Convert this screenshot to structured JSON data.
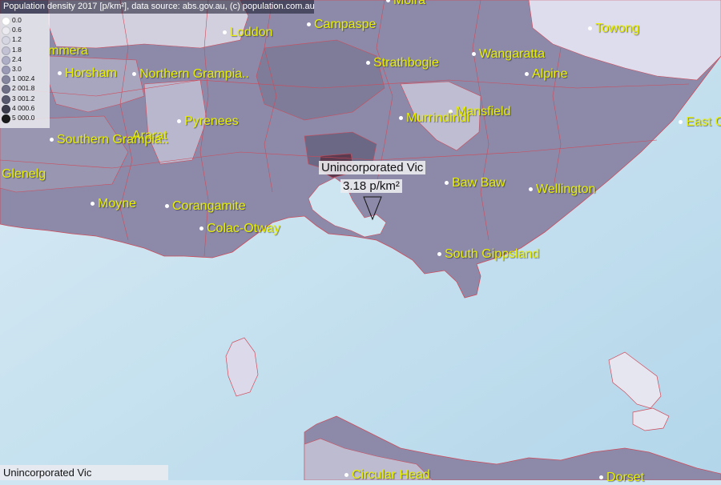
{
  "header": {
    "title": "Population density 2017 [p/km²], data source: abs.gov.au, (c) population.com.au"
  },
  "legend": {
    "items": [
      {
        "label": "0.0",
        "color": "#ffffff"
      },
      {
        "label": "0.6",
        "color": "#eaeaf0"
      },
      {
        "label": "1.2",
        "color": "#d6d6e2"
      },
      {
        "label": "1.8",
        "color": "#c2c2d4"
      },
      {
        "label": "2.4",
        "color": "#aeaec6"
      },
      {
        "label": "3.0",
        "color": "#9a9ab6"
      },
      {
        "label": "1 002.4",
        "color": "#85859f"
      },
      {
        "label": "2 001.8",
        "color": "#6f6f88"
      },
      {
        "label": "3 001.2",
        "color": "#58586e"
      },
      {
        "label": "4 000.6",
        "color": "#3c3c4c"
      },
      {
        "label": "5 000.0",
        "color": "#1a1a1a"
      }
    ]
  },
  "places": [
    {
      "name": "Moira"
    },
    {
      "name": "Campaspe"
    },
    {
      "name": "Loddon"
    },
    {
      "name": "Towong"
    },
    {
      "name": "Wangaratta"
    },
    {
      "name": "Strathbogie"
    },
    {
      "name": "Alpine"
    },
    {
      "name": "mmera"
    },
    {
      "name": "Horsham"
    },
    {
      "name": "Northern Grampia.."
    },
    {
      "name": "Mansfield"
    },
    {
      "name": "Murrindindi"
    },
    {
      "name": "Pyrenees"
    },
    {
      "name": "East G"
    },
    {
      "name": "Ararat"
    },
    {
      "name": "Southern Grampia.."
    },
    {
      "name": "Glenelg"
    },
    {
      "name": "Baw Baw"
    },
    {
      "name": "Wellington"
    },
    {
      "name": "Moyne"
    },
    {
      "name": "Corangamite"
    },
    {
      "name": "Colac-Otway"
    },
    {
      "name": "South Gippsland"
    },
    {
      "name": "Circular Head"
    },
    {
      "name": "Dorset"
    }
  ],
  "callout": {
    "title": "Unincorporated Vic",
    "value": "3.18 p/km²"
  },
  "footer": {
    "label": "Unincorporated Vic"
  },
  "colors": {
    "sea": "#cfe6f2",
    "land": "#8a88a6",
    "border": "#d04a5a",
    "label": "#e8f000"
  }
}
